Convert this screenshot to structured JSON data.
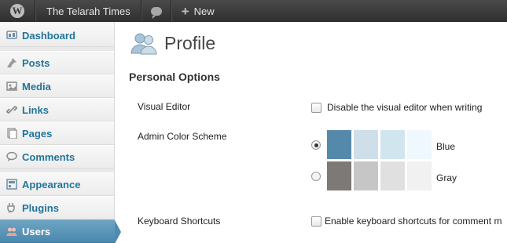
{
  "admin_bar": {
    "site_name": "The Telarah Times",
    "new_label": "New"
  },
  "sidebar": {
    "items": [
      {
        "label": "Dashboard",
        "icon": "dashboard-icon"
      },
      {
        "label": "Posts",
        "icon": "pin-icon"
      },
      {
        "label": "Media",
        "icon": "media-icon"
      },
      {
        "label": "Links",
        "icon": "link-icon"
      },
      {
        "label": "Pages",
        "icon": "page-icon"
      },
      {
        "label": "Comments",
        "icon": "comment-icon"
      },
      {
        "label": "Appearance",
        "icon": "appearance-icon"
      },
      {
        "label": "Plugins",
        "icon": "plugin-icon"
      },
      {
        "label": "Users",
        "icon": "users-icon",
        "current": true
      }
    ]
  },
  "main": {
    "title": "Profile",
    "section": "Personal Options",
    "visual_editor": {
      "label": "Visual Editor",
      "checkbox_label": "Disable the visual editor when writing",
      "checked": false
    },
    "color_scheme": {
      "label": "Admin Color Scheme",
      "options": [
        {
          "name": "Blue",
          "selected": true,
          "colors": [
            "#5589aa",
            "#cfdfe9",
            "#d1e5ee",
            "#eff8ff"
          ]
        },
        {
          "name": "Gray",
          "selected": false,
          "colors": [
            "#7c7976",
            "#c6c6c6",
            "#e0e0e0",
            "#f1f1f1"
          ]
        }
      ]
    },
    "keyboard_shortcuts": {
      "label": "Keyboard Shortcuts",
      "checkbox_label": "Enable keyboard shortcuts for comment m",
      "checked": false
    }
  },
  "colors": {
    "admin_bar": "#3a3a3a",
    "link": "#21759b",
    "current_menu": "#4a88ae"
  }
}
